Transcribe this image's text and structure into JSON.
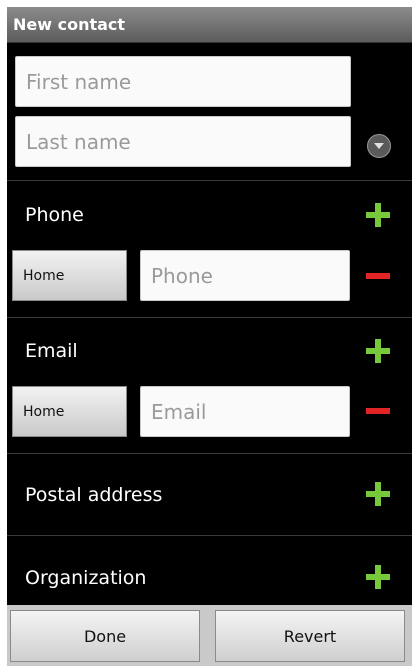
{
  "title": "New contact",
  "name": {
    "first_placeholder": "First name",
    "last_placeholder": "Last name"
  },
  "sections": {
    "phone": {
      "label": "Phone",
      "type": "Home",
      "placeholder": "Phone"
    },
    "email": {
      "label": "Email",
      "type": "Home",
      "placeholder": "Email"
    },
    "postal": {
      "label": "Postal address"
    },
    "organization": {
      "label": "Organization"
    }
  },
  "buttons": {
    "done": "Done",
    "revert": "Revert"
  },
  "colors": {
    "add": "#77c83a",
    "remove": "#e32424"
  },
  "icons": [
    "plus-icon",
    "minus-icon",
    "expand-icon"
  ]
}
